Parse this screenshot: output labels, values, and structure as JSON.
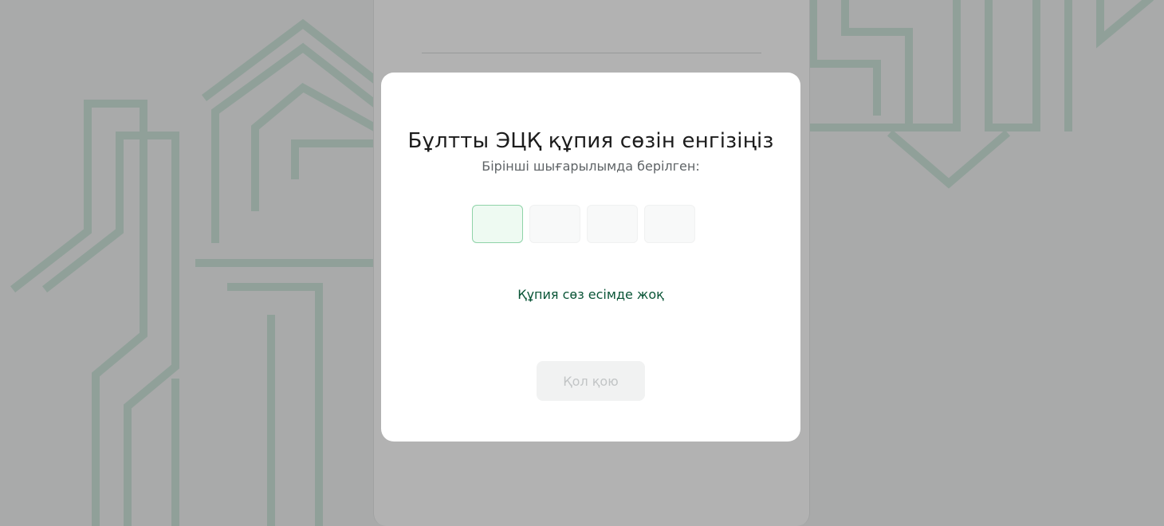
{
  "modal": {
    "title": "Бұлтты ЭЦҚ құпия сөзін енгізіңіз",
    "subtitle": "Бірінші шығарылымда берілген:",
    "pin_fields": [
      {
        "value": "",
        "active": true
      },
      {
        "value": "",
        "active": false
      },
      {
        "value": "",
        "active": false
      },
      {
        "value": "",
        "active": false
      }
    ],
    "forgot_link": "Құпия сөз есімде жоқ",
    "submit_label": "Қол қою",
    "submit_enabled": false
  },
  "colors": {
    "accent_green": "#0a5537",
    "active_pin_border": "#8fd3a8",
    "overlay": "rgba(0,0,0,0.30)",
    "disabled_button_bg": "#f1f2f2",
    "disabled_button_text": "#c2c5c6"
  }
}
